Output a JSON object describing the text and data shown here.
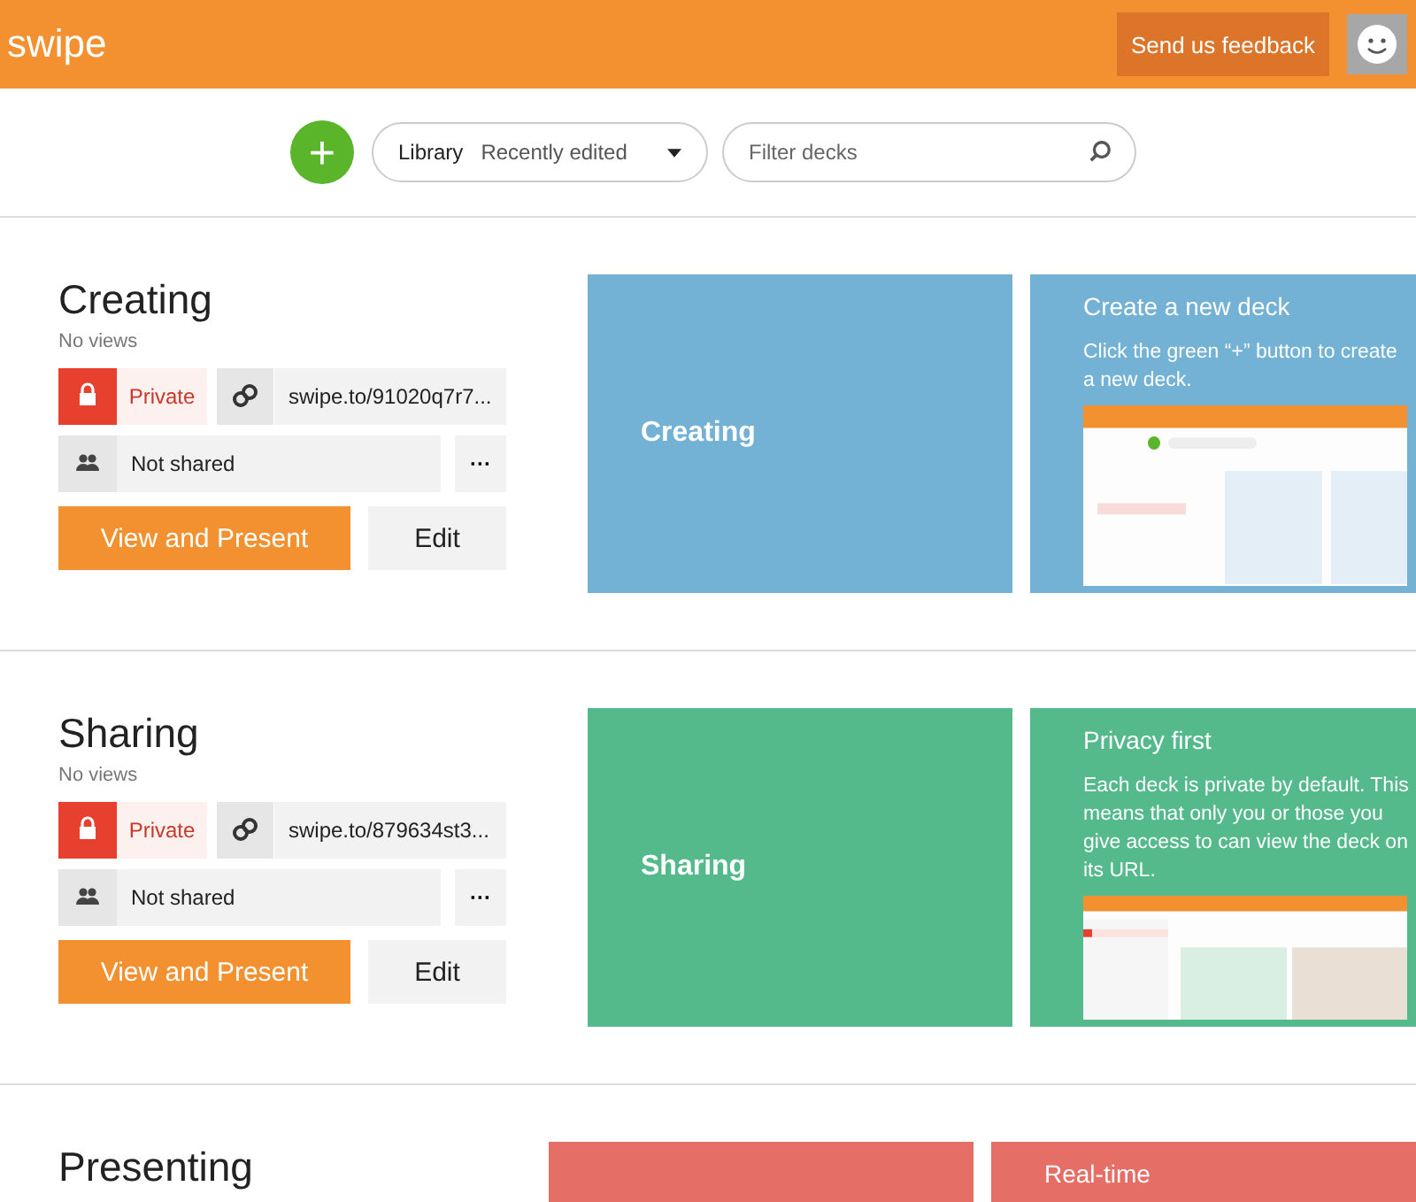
{
  "header": {
    "logo": "swipe",
    "feedback_button": "Send us feedback"
  },
  "toolbar": {
    "add_button": "+",
    "library_label": "Library",
    "sort_value": "Recently edited",
    "filter": {
      "placeholder": "Filter decks"
    }
  },
  "sections": [
    {
      "title": "Creating",
      "views": "No views",
      "privacy": "Private",
      "private": true,
      "url": "swipe.to/91020q7r7...",
      "sharing": "Not shared",
      "more": "···",
      "present_button": "View and Present",
      "edit_button": "Edit",
      "tile_label": "Creating",
      "color": "#73b2d4",
      "info_title": "Create a new deck",
      "info_text": "Click the green “+” button to create a new deck.",
      "kind": "creating"
    },
    {
      "title": "Sharing",
      "views": "No views",
      "privacy": "Private",
      "private": true,
      "url": "swipe.to/879634st3...",
      "sharing": "Not shared",
      "more": "···",
      "present_button": "View and Present",
      "edit_button": "Edit",
      "tile_label": "Sharing",
      "color": "#55ba8b",
      "info_title": "Privacy first",
      "info_text": "Each deck is private by default. This means that only you or those you give access to can view the deck on its URL.",
      "kind": "privacy"
    },
    {
      "title": "Presenting",
      "color": "#e56e66",
      "info_title": "Real-time"
    }
  ]
}
